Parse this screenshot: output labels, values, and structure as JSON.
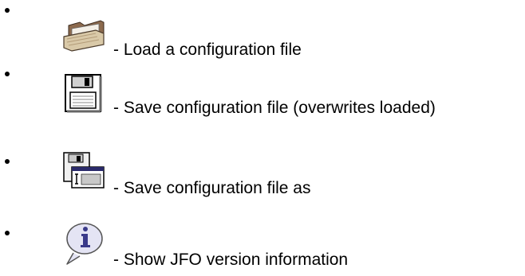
{
  "items": [
    {
      "icon": "folder-icon",
      "text": "- Load a configuration file"
    },
    {
      "icon": "floppy-disk-icon",
      "text": "- Save configuration file (overwrites loaded)"
    },
    {
      "icon": "floppy-disk-save-as-icon",
      "text": "- Save configuration file as"
    },
    {
      "icon": "info-speech-bubble-icon",
      "text": "- Show JFO version information"
    }
  ]
}
